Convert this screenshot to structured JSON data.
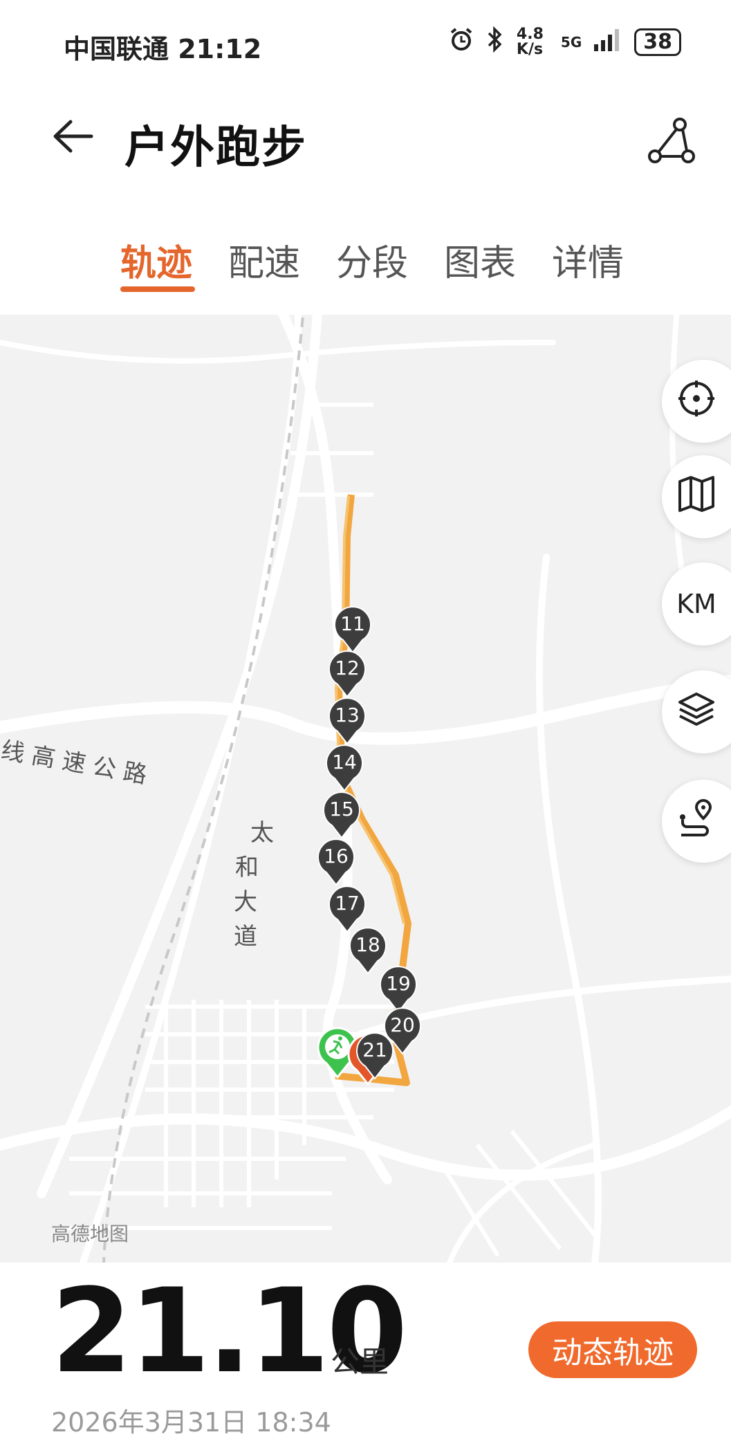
{
  "status_bar": {
    "carrier_time": "中国联通 21:12",
    "speed": "4.8 K/s",
    "network": "5G",
    "battery": "38",
    "icons": [
      "alarm-icon",
      "bluetooth-icon",
      "signal-icon",
      "battery-icon"
    ]
  },
  "header": {
    "title": "户外跑步",
    "back_icon": "arrow-left-icon",
    "share_icon": "route-share-icon"
  },
  "tabs": [
    {
      "label": "轨迹",
      "active": true
    },
    {
      "label": "配速",
      "active": false
    },
    {
      "label": "分段",
      "active": false
    },
    {
      "label": "图表",
      "active": false
    },
    {
      "label": "详情",
      "active": false
    }
  ],
  "map": {
    "road_label_1": "线 高 速 公 路",
    "road_label_2": [
      "太",
      "和",
      "大",
      "道"
    ],
    "attribution": "高德地图",
    "km_markers": [
      "11",
      "12",
      "13",
      "14",
      "15",
      "16",
      "17",
      "18",
      "19",
      "20",
      "21"
    ],
    "controls": [
      "locate-icon",
      "map-icon",
      "KM",
      "layers-icon",
      "route-icon"
    ],
    "colors": {
      "track": "#f1a640",
      "marker": "#3d3d3d",
      "start": "#3ec24e",
      "end": "#e2562a"
    }
  },
  "summary": {
    "distance": "21.10",
    "unit": "公里",
    "dynamic_button": "动态轨迹",
    "datetime": "2026年3月31日 18:34"
  }
}
